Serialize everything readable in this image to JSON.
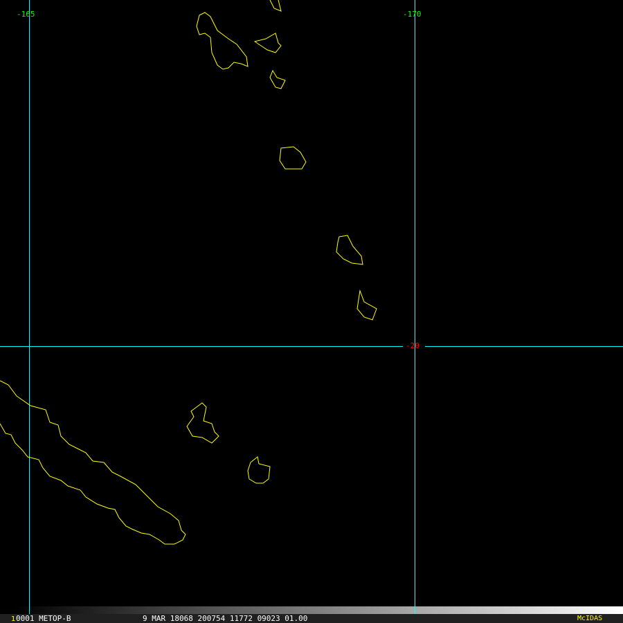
{
  "map": {
    "lon_labels": [
      "-165",
      "-170"
    ],
    "lat_labels": [
      "-20"
    ],
    "colors": {
      "coast": "#ffff00",
      "grid": "#00ffff",
      "lon_label": "#00ff00",
      "lat_label": "#ff0000"
    }
  },
  "status_bar": {
    "frame_number": "1",
    "product": "0001 METOP-B",
    "info": "9 MAR 18068 200754 11772 09023 01.00",
    "brand": "McIDAS"
  }
}
